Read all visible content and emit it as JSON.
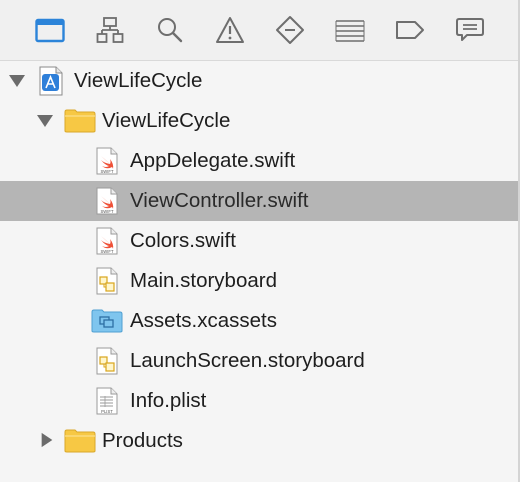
{
  "toolbar": {
    "tabs": [
      {
        "name": "project-navigator",
        "icon": "folder-icon",
        "active": true
      },
      {
        "name": "symbol-navigator",
        "icon": "hierarchy-icon"
      },
      {
        "name": "find-navigator",
        "icon": "magnifier-icon"
      },
      {
        "name": "issue-navigator",
        "icon": "warning-triangle-icon"
      },
      {
        "name": "test-navigator",
        "icon": "diamond-minus-icon"
      },
      {
        "name": "debug-navigator",
        "icon": "lines-table-icon"
      },
      {
        "name": "breakpoint-navigator",
        "icon": "breakpoint-tag-icon"
      },
      {
        "name": "report-navigator",
        "icon": "speech-bubble-icon"
      }
    ],
    "active_color": "#2c84d9",
    "inactive_color": "#6e6e6e"
  },
  "tree": {
    "project": {
      "label": "ViewLifeCycle",
      "icon": "xcode-project-icon",
      "expanded": true
    },
    "group": {
      "label": "ViewLifeCycle",
      "icon": "folder-icon",
      "expanded": true
    },
    "files": [
      {
        "label": "AppDelegate.swift",
        "icon": "swift-file-icon",
        "icon_caption": "SWIFT",
        "selected": false
      },
      {
        "label": "ViewController.swift",
        "icon": "swift-file-icon",
        "icon_caption": "SWIFT",
        "selected": true
      },
      {
        "label": "Colors.swift",
        "icon": "swift-file-icon",
        "icon_caption": "SWIFT",
        "selected": false
      },
      {
        "label": "Main.storyboard",
        "icon": "storyboard-file-icon",
        "selected": false
      },
      {
        "label": "Assets.xcassets",
        "icon": "asset-catalog-icon",
        "selected": false
      },
      {
        "label": "LaunchScreen.storyboard",
        "icon": "storyboard-file-icon",
        "selected": false
      },
      {
        "label": "Info.plist",
        "icon": "plist-file-icon",
        "icon_caption": "PLIST",
        "selected": false
      }
    ],
    "products": {
      "label": "Products",
      "icon": "folder-icon",
      "expanded": false
    },
    "selection_color": "#b5b5b5"
  }
}
